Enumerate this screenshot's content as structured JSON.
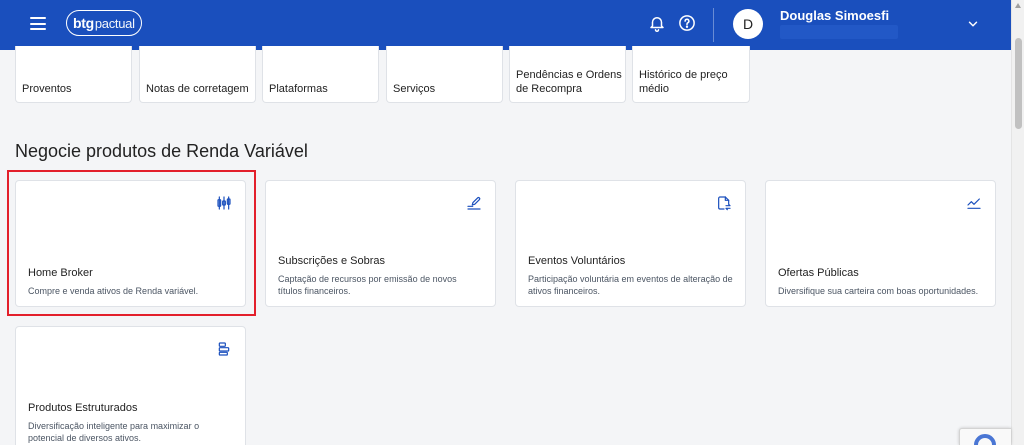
{
  "header": {
    "logo_mark": "btg",
    "logo_text": "pactual",
    "avatar_initial": "D",
    "user_name": "Douglas Simoesfi"
  },
  "quick_links": [
    {
      "label": "Proventos"
    },
    {
      "label": "Notas de corretagem"
    },
    {
      "label": "Plataformas"
    },
    {
      "label": "Serviços"
    },
    {
      "label": "Pendências e Ordens de Recompra"
    },
    {
      "label": "Histórico de preço médio"
    }
  ],
  "section": {
    "title": "Negocie produtos de Renda Variável"
  },
  "cards": [
    {
      "title": "Home Broker",
      "description": "Compre e venda ativos de Renda variável.",
      "icon": "candlestick-chart-icon"
    },
    {
      "title": "Subscrições e Sobras",
      "description": "Captação de recursos por emissão de novos títulos financeiros.",
      "icon": "sign-pen-icon"
    },
    {
      "title": "Eventos Voluntários",
      "description": "Participação voluntária em eventos de alteração de ativos financeiros.",
      "icon": "document-exchange-icon"
    },
    {
      "title": "Ofertas Públicas",
      "description": "Diversifique sua carteira com boas oportunidades.",
      "icon": "trend-line-icon"
    },
    {
      "title": "Produtos Estruturados",
      "description": "Diversificação inteligente para maximizar o potencial de diversos ativos.",
      "icon": "stacked-layers-icon"
    }
  ],
  "colors": {
    "brand_blue": "#1a4fbd",
    "highlight_red": "#e3202b"
  }
}
